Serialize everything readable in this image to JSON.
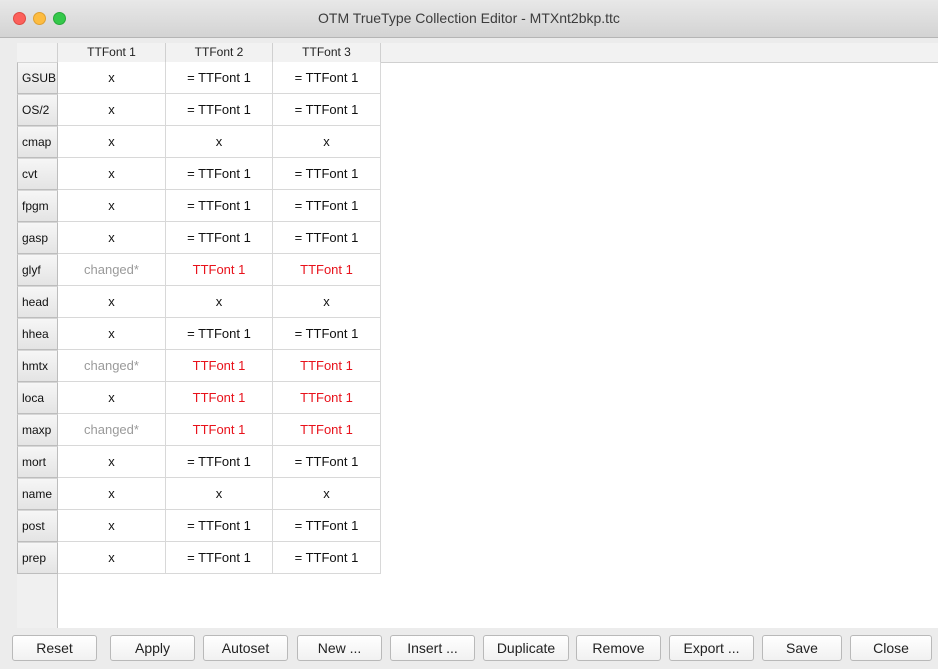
{
  "window": {
    "title": "OTM TrueType Collection Editor - MTXnt2bkp.ttc"
  },
  "columns": [
    "TTFont 1",
    "TTFont 2",
    "TTFont 3"
  ],
  "rows": [
    {
      "label": "GSUB",
      "cells": [
        {
          "text": "x",
          "style": "normal"
        },
        {
          "text": "= TTFont 1",
          "style": "normal"
        },
        {
          "text": "= TTFont 1",
          "style": "normal"
        }
      ]
    },
    {
      "label": "OS/2",
      "cells": [
        {
          "text": "x",
          "style": "normal"
        },
        {
          "text": "= TTFont 1",
          "style": "normal"
        },
        {
          "text": "= TTFont 1",
          "style": "normal"
        }
      ]
    },
    {
      "label": "cmap",
      "cells": [
        {
          "text": "x",
          "style": "normal"
        },
        {
          "text": "x",
          "style": "normal"
        },
        {
          "text": "x",
          "style": "normal"
        }
      ]
    },
    {
      "label": "cvt",
      "cells": [
        {
          "text": "x",
          "style": "normal"
        },
        {
          "text": "= TTFont 1",
          "style": "normal"
        },
        {
          "text": "= TTFont 1",
          "style": "normal"
        }
      ]
    },
    {
      "label": "fpgm",
      "cells": [
        {
          "text": "x",
          "style": "normal"
        },
        {
          "text": "= TTFont 1",
          "style": "normal"
        },
        {
          "text": "= TTFont 1",
          "style": "normal"
        }
      ]
    },
    {
      "label": "gasp",
      "cells": [
        {
          "text": "x",
          "style": "normal"
        },
        {
          "text": "= TTFont 1",
          "style": "normal"
        },
        {
          "text": "= TTFont 1",
          "style": "normal"
        }
      ]
    },
    {
      "label": "glyf",
      "cells": [
        {
          "text": "changed*",
          "style": "gray"
        },
        {
          "text": "TTFont 1",
          "style": "red"
        },
        {
          "text": "TTFont 1",
          "style": "red"
        }
      ]
    },
    {
      "label": "head",
      "cells": [
        {
          "text": "x",
          "style": "normal"
        },
        {
          "text": "x",
          "style": "normal"
        },
        {
          "text": "x",
          "style": "normal"
        }
      ]
    },
    {
      "label": "hhea",
      "cells": [
        {
          "text": "x",
          "style": "normal"
        },
        {
          "text": "= TTFont 1",
          "style": "normal"
        },
        {
          "text": "= TTFont 1",
          "style": "normal"
        }
      ]
    },
    {
      "label": "hmtx",
      "cells": [
        {
          "text": "changed*",
          "style": "gray"
        },
        {
          "text": "TTFont 1",
          "style": "red"
        },
        {
          "text": "TTFont 1",
          "style": "red"
        }
      ]
    },
    {
      "label": "loca",
      "cells": [
        {
          "text": "x",
          "style": "normal"
        },
        {
          "text": "TTFont 1",
          "style": "red"
        },
        {
          "text": "TTFont 1",
          "style": "red"
        }
      ]
    },
    {
      "label": "maxp",
      "cells": [
        {
          "text": "changed*",
          "style": "gray"
        },
        {
          "text": "TTFont 1",
          "style": "red"
        },
        {
          "text": "TTFont 1",
          "style": "red"
        }
      ]
    },
    {
      "label": "mort",
      "cells": [
        {
          "text": "x",
          "style": "normal"
        },
        {
          "text": "= TTFont 1",
          "style": "normal"
        },
        {
          "text": "= TTFont 1",
          "style": "normal"
        }
      ]
    },
    {
      "label": "name",
      "cells": [
        {
          "text": "x",
          "style": "normal"
        },
        {
          "text": "x",
          "style": "normal"
        },
        {
          "text": "x",
          "style": "normal"
        }
      ]
    },
    {
      "label": "post",
      "cells": [
        {
          "text": "x",
          "style": "normal"
        },
        {
          "text": "= TTFont 1",
          "style": "normal"
        },
        {
          "text": "= TTFont 1",
          "style": "normal"
        }
      ]
    },
    {
      "label": "prep",
      "cells": [
        {
          "text": "x",
          "style": "normal"
        },
        {
          "text": "= TTFont 1",
          "style": "normal"
        },
        {
          "text": "= TTFont 1",
          "style": "normal"
        }
      ]
    }
  ],
  "buttons": [
    "Reset",
    "Apply",
    "Autoset",
    "New ...",
    "Insert ...",
    "Duplicate",
    "Remove",
    "Export ...",
    "Save",
    "Close"
  ],
  "colors": {
    "conflict": "#e8121b",
    "changed": "#9a9a9a"
  }
}
